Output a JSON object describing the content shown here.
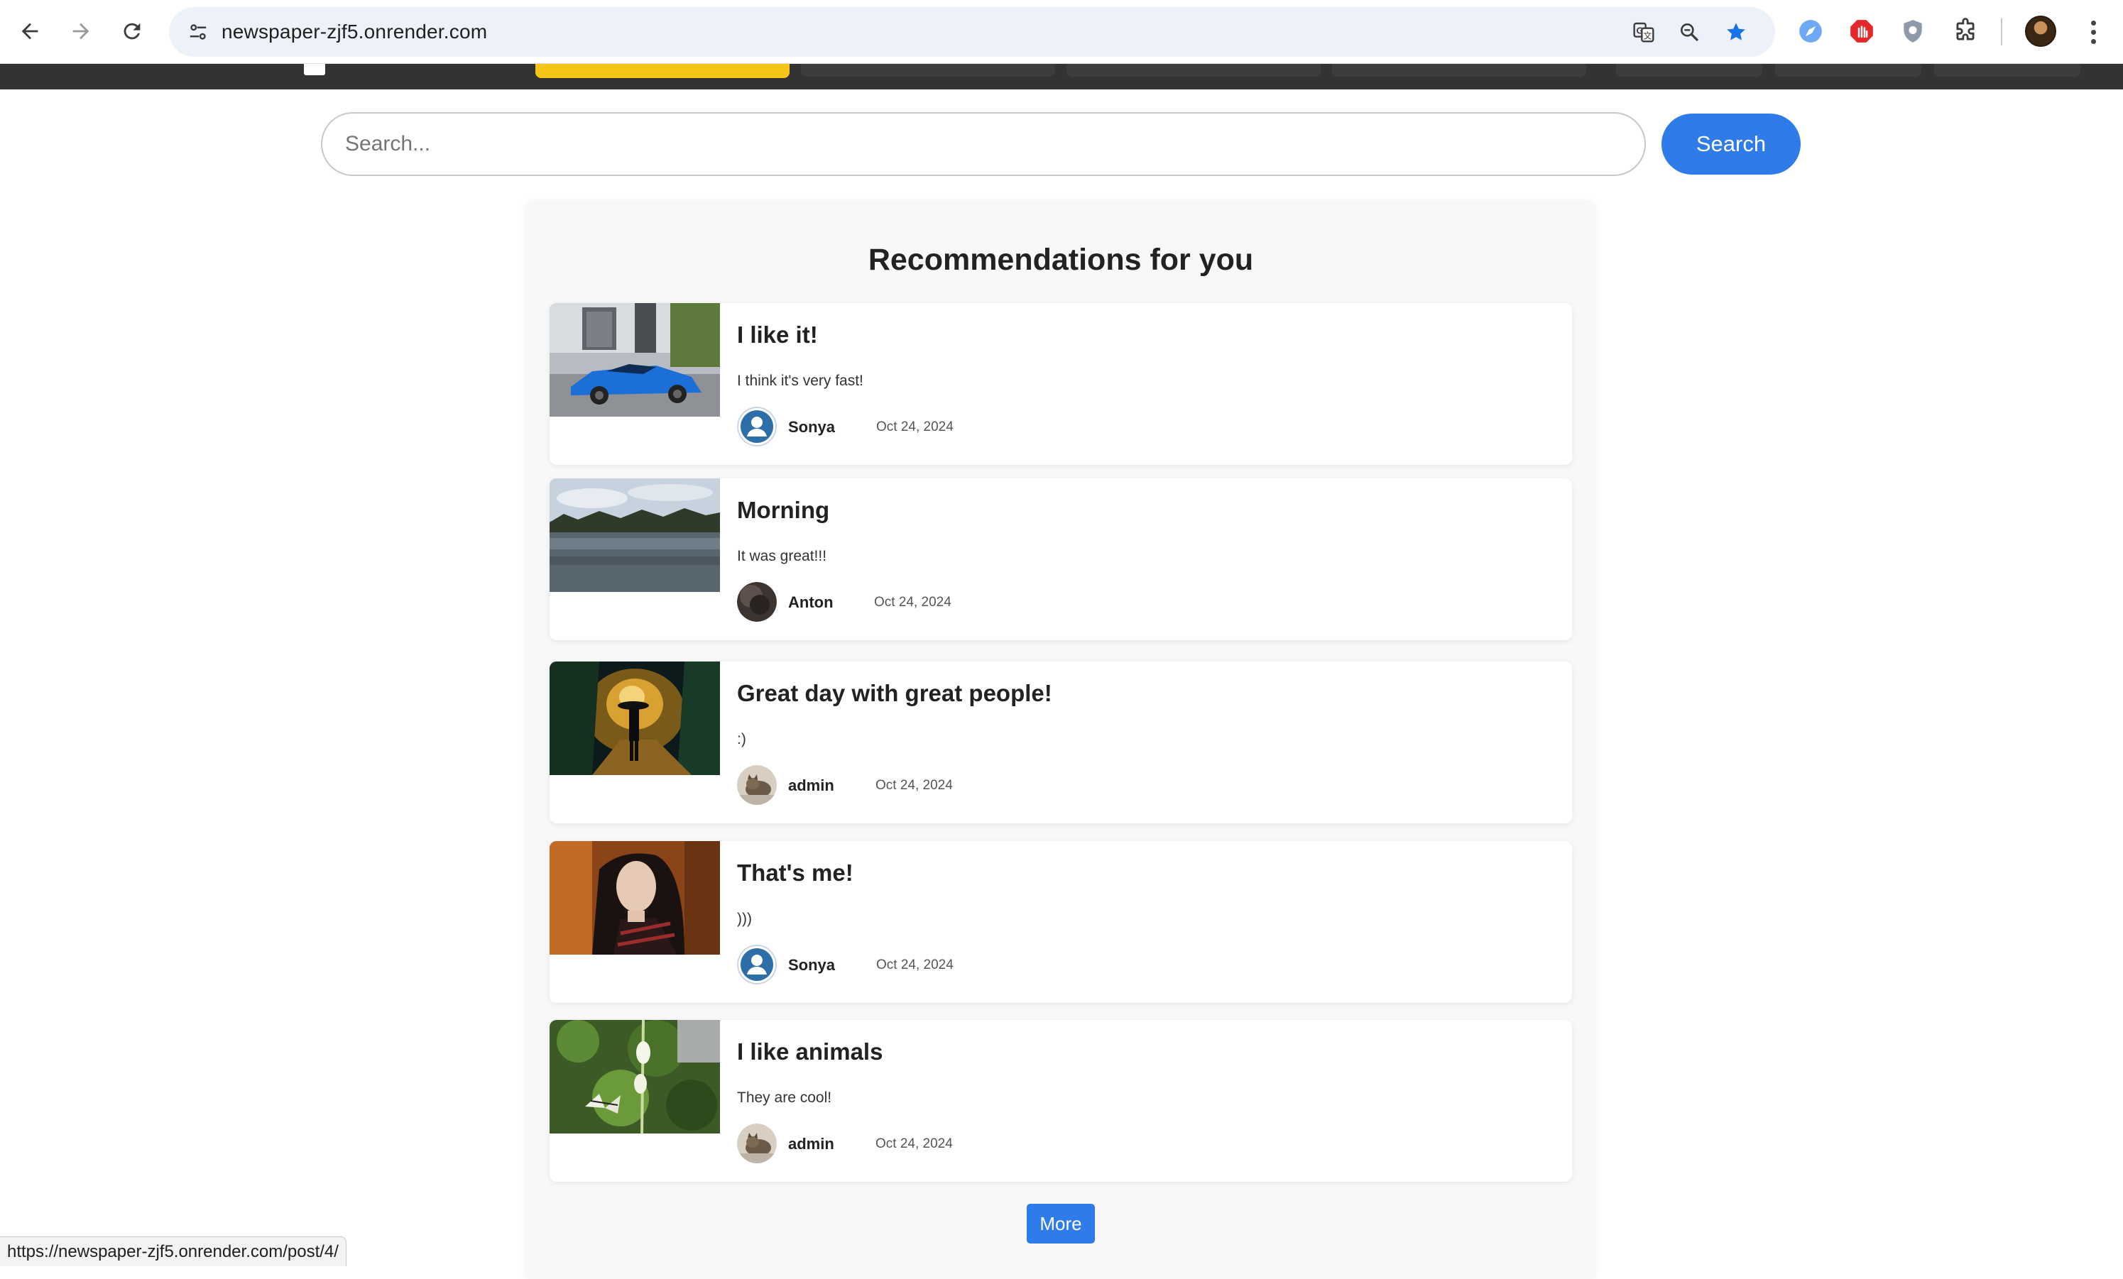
{
  "browser": {
    "url": "newspaper-zjf5.onrender.com",
    "status_url": "https://newspaper-zjf5.onrender.com/post/4/",
    "icons": {
      "back": "back-arrow-icon",
      "forward": "forward-arrow-icon",
      "reload": "reload-icon",
      "site_info": "tune-icon",
      "translate": "translate-icon",
      "zoom": "zoom-icon",
      "bookmark": "bookmark-star-icon",
      "extensions": "puzzle-icon",
      "menu": "kebab-menu-icon"
    },
    "colors": {
      "bookmark_star": "#1a73e8"
    }
  },
  "search": {
    "placeholder": "Search...",
    "value": "",
    "button_label": "Search"
  },
  "recommendations": {
    "title": "Recommendations for you",
    "more_label": "More",
    "posts": [
      {
        "title": "I like it!",
        "excerpt": "I think it's very fast!",
        "author": "Sonya",
        "date": "Oct 24, 2024",
        "image": "blue-sports-car",
        "avatar": "default-user-avatar"
      },
      {
        "title": "Morning",
        "excerpt": "It was great!!!",
        "author": "Anton",
        "date": "Oct 24, 2024",
        "image": "lake-morning",
        "avatar": "dark-photo-avatar"
      },
      {
        "title": "Great day with great people!",
        "excerpt": ":)",
        "author": "admin",
        "date": "Oct 24, 2024",
        "image": "night-street-umbrella",
        "avatar": "cat-photo-avatar"
      },
      {
        "title": "That's me!",
        "excerpt": ")))",
        "author": "Sonya",
        "date": "Oct 24, 2024",
        "image": "portrait-woman",
        "avatar": "default-user-avatar"
      },
      {
        "title": "I like animals",
        "excerpt": "They are cool!",
        "author": "admin",
        "date": "Oct 24, 2024",
        "image": "butterfly-plants",
        "avatar": "cat-photo-avatar"
      }
    ]
  },
  "theme": {
    "accent": "#2f7bea",
    "nav_bg": "#333333",
    "nav_active": "#f5c518",
    "panel_bg": "#f8f8f8"
  }
}
